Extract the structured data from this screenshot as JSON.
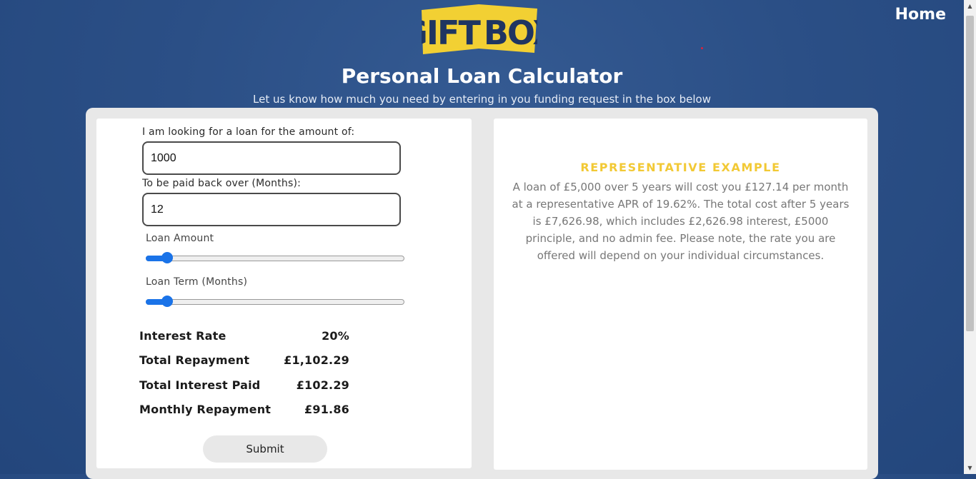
{
  "brand": {
    "logo_text_left": "GIFT",
    "logo_text_right": "BOX",
    "logo_color": "#f2d033",
    "logo_text_color": "#1f3561"
  },
  "nav": {
    "home_label": "Home"
  },
  "header": {
    "title": "Personal Loan Calculator",
    "subtitle": "Let us know how much you need by entering in you funding request in the box below"
  },
  "form": {
    "amount_label": "I am looking for a loan for the amount of:",
    "amount_value": "1000",
    "term_label": "To be paid back over (Months):",
    "term_value": "12",
    "amount_slider_label": "Loan Amount",
    "amount_slider_fraction": 0.04,
    "term_slider_label": "Loan Term (Months)",
    "term_slider_fraction": 0.04,
    "slider_color": "#1a73e8",
    "submit_label": "Submit"
  },
  "results": [
    {
      "label": "Interest Rate",
      "value": "20%"
    },
    {
      "label": "Total Repayment",
      "value": "£1,102.29"
    },
    {
      "label": "Total Interest Paid",
      "value": "£102.29"
    },
    {
      "label": "Monthly Repayment",
      "value": "£91.86"
    }
  ],
  "representative": {
    "heading": "REPRESENTATIVE EXAMPLE",
    "heading_color": "#f2c935",
    "body": "A loan of £5,000 over 5 years will cost you £127.14 per month at a representative APR of 19.62%. The total cost after 5 years is £7,626.98, which includes £2,626.98 interest, £5000 principle, and no admin fee. Please note, the rate you are offered will depend on your individual circumstances."
  },
  "colors": {
    "background": "#2b4f86",
    "panel": "#e8e8e8"
  }
}
